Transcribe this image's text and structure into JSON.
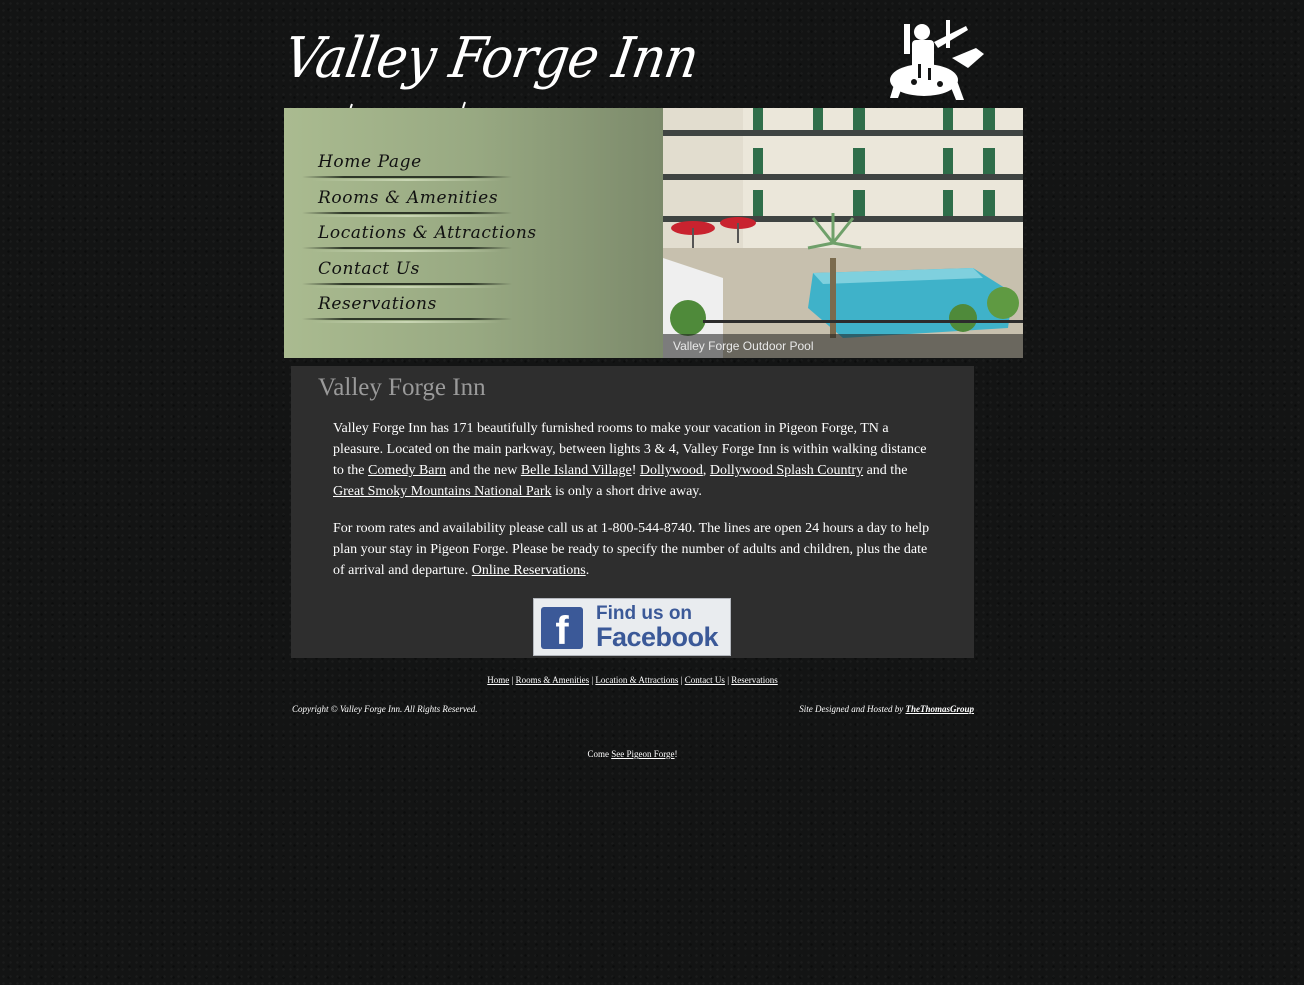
{
  "header": {
    "logo_text": "Valley Forge Inn"
  },
  "nav": {
    "items": [
      {
        "label": "Home Page"
      },
      {
        "label": "Rooms & Amenities"
      },
      {
        "label": "Locations & Attractions"
      },
      {
        "label": "Contact Us"
      },
      {
        "label": "Reservations"
      }
    ]
  },
  "photo": {
    "caption": "Valley Forge Outdoor Pool"
  },
  "main": {
    "title": "Valley Forge Inn",
    "p1": {
      "t1": "Valley Forge Inn has 171 beautifully furnished rooms to make your vacation in Pigeon Forge, TN a pleasure. Located on the main parkway, between lights 3 & 4, Valley Forge Inn is within walking distance to the ",
      "link1": "Comedy Barn",
      "t2": " and the new ",
      "link2": "Belle Island Village",
      "t3": "! ",
      "link3": "Dollywood",
      "t4": ", ",
      "link4": "Dollywood Splash Country",
      "t5": " and the ",
      "link5": "Great Smoky Mountains National Park",
      "t6": " is only a short drive away."
    },
    "p2": {
      "t1": "For room rates and availability please call us at 1-800-544-8740. The lines are open 24 hours a day to help plan your stay in Pigeon Forge. Please be ready to specify the number of adults and children, plus the date of arrival and departure. ",
      "link1": "Online Reservations",
      "t2": "."
    },
    "facebook": {
      "line1": "Find us on",
      "line2": "Facebook",
      "logo": "f"
    }
  },
  "footer": {
    "nav": [
      "Home",
      "Rooms & Amenities",
      "Location & Attractions",
      "Contact Us",
      "Reservations"
    ],
    "separator": " | ",
    "copyright": "Copyright © Valley Forge Inn. All Rights Reserved.",
    "designed_prefix": "Site Designed and Hosted by ",
    "designed_link": "TheThomasGroup",
    "come_prefix": "Come ",
    "come_link": "See Pigeon Forge",
    "come_suffix": "!"
  }
}
